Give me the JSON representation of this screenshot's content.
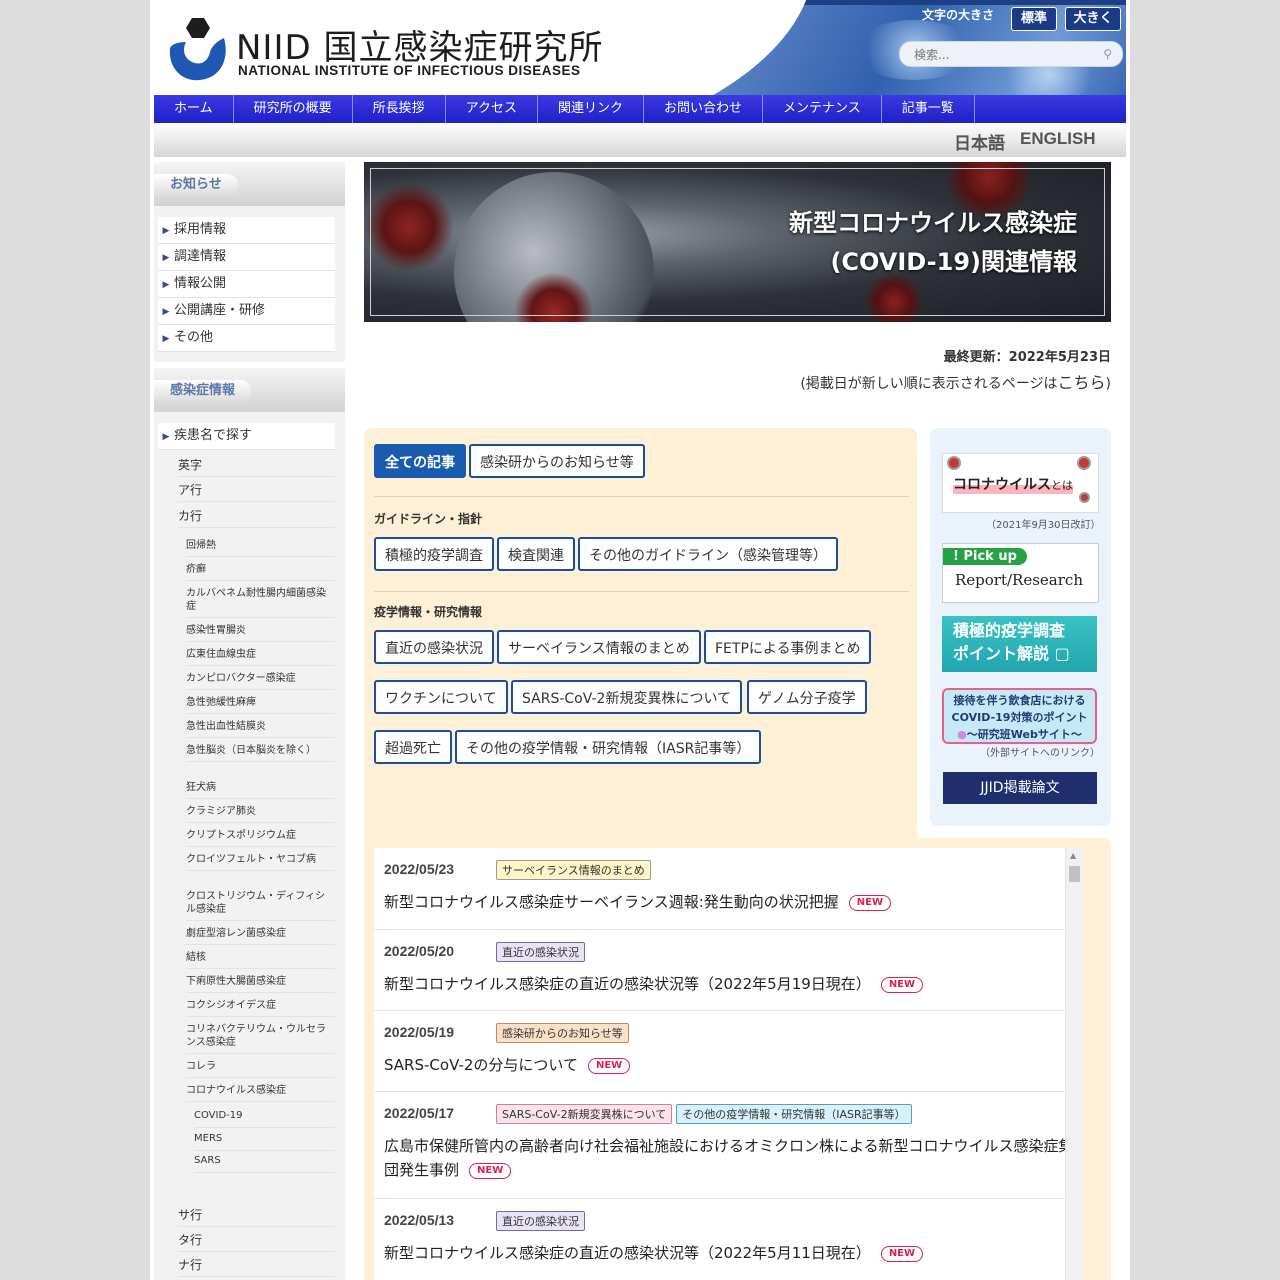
{
  "header": {
    "logo_name": "NIID 国立感染症研究所",
    "logo_en": "NATIONAL INSTITUTE OF INFECTIOUS DISEASES",
    "font_size_label": "文字の大きさ",
    "font_standard": "標準",
    "font_large": "大きく",
    "search_placeholder": "検索..."
  },
  "nav": [
    "ホーム",
    "研究所の概要",
    "所長挨拶",
    "アクセス",
    "関連リンク",
    "お問い合わせ",
    "メンテナンス",
    "記事一覧"
  ],
  "lang": {
    "ja": "日本語",
    "en": "ENGLISH"
  },
  "sidebar": {
    "notice_head": "お知らせ",
    "notice_items": [
      "採用情報",
      "調達情報",
      "情報公開",
      "公開講座・研修",
      "その他"
    ],
    "disease_head": "感染症情報",
    "search_by_name": "疾患名で探す",
    "groups": [
      "英字",
      "ア行",
      "カ行"
    ],
    "ka_items": [
      "回帰熱",
      "疥癬",
      "カルバペネム耐性腸内細菌感染症",
      "感染性胃腸炎",
      "広東住血線虫症",
      "カンピロバクター感染症",
      "急性弛緩性麻痺",
      "急性出血性結膜炎",
      "急性脳炎（日本脳炎を除く）",
      "狂犬病",
      "クラミジア肺炎",
      "クリプトスポリジウム症",
      "クロイツフェルト・ヤコブ病",
      "クロストリジウム・ディフィシル感染症",
      "劇症型溶レン菌感染症",
      "結核",
      "下痢原性大腸菌感染症",
      "コクシジオイデス症",
      "コリネバクテリウム・ウルセランス感染症",
      "コレラ",
      "コロナウイルス感染症"
    ],
    "corona_sub": [
      "COVID-19",
      "MERS",
      "SARS"
    ],
    "more_groups": [
      "サ行",
      "タ行",
      "ナ行"
    ]
  },
  "banner": {
    "line1": "新型コロナウイルス感染症",
    "line2": "(COVID-19)関連情報"
  },
  "updated": "最終更新：2022年5月23日",
  "recent_note": {
    "text": "(掲載日が新しい順に表示されるページは",
    "link": "こちら",
    "close": ")"
  },
  "filters": {
    "top": [
      "全ての記事",
      "感染研からのお知らせ等"
    ],
    "section1": "ガイドライン・指針",
    "guidelines": [
      "積極的疫学調査",
      "検査関連",
      "その他のガイドライン（感染管理等）"
    ],
    "section2": "疫学情報・研究情報",
    "epi_row1": [
      "直近の感染状況",
      "サーベイランス情報のまとめ",
      "FETPによる事例まとめ"
    ],
    "epi_row2": [
      "ワクチンについて",
      "SARS-CoV-2新規変異株について",
      "ゲノム分子疫学"
    ],
    "epi_row3": [
      "超過死亡",
      "その他の疫学情報・研究情報（IASR記事等）"
    ]
  },
  "right": {
    "corona_main": "コロナウイルス",
    "corona_small": "とは",
    "corona_date": "（2021年9月30日改訂）",
    "pickup": "! Pick up",
    "pickup_sub": "Report/Research",
    "seki_line1": "積極的疫学調査",
    "seki_line2": "ポイント解説",
    "rest_line1": "接待を伴う飲食店における",
    "rest_line2": "COVID-19対策のポイント",
    "rest_line3": "～研究班Webサイト～",
    "ext_note": "（外部サイトへのリンク）",
    "jjid": "JJID掲載論文"
  },
  "news": [
    {
      "date": "2022/05/23",
      "tags": [
        {
          "label": "サーベイランス情報のまとめ",
          "kind": "t-surv"
        }
      ],
      "title": "新型コロナウイルス感染症サーベイランス週報:発生動向の状況把握",
      "badge": "NEW"
    },
    {
      "date": "2022/05/20",
      "tags": [
        {
          "label": "直近の感染状況",
          "kind": "t-recent"
        }
      ],
      "title": "新型コロナウイルス感染症の直近の感染状況等（2022年5月19日現在）",
      "badge": "NEW"
    },
    {
      "date": "2022/05/19",
      "tags": [
        {
          "label": "感染研からのお知らせ等",
          "kind": "t-notice"
        }
      ],
      "title": "SARS-CoV-2の分与について",
      "badge": "NEW"
    },
    {
      "date": "2022/05/17",
      "tags": [
        {
          "label": "SARS-CoV-2新規変異株について",
          "kind": "t-variant"
        },
        {
          "label": "その他の疫学情報・研究情報（IASR記事等）",
          "kind": "t-other"
        }
      ],
      "title": "広島市保健所管内の高齢者向け社会福祉施設におけるオミクロン株による新型コロナウイルス感染症集団発生事例",
      "badge": "NEW"
    },
    {
      "date": "2022/05/13",
      "tags": [
        {
          "label": "直近の感染状況",
          "kind": "t-recent"
        }
      ],
      "title": "新型コロナウイルス感染症の直近の感染状況等（2022年5月11日現在）",
      "badge": "NEW"
    }
  ],
  "colors": {
    "nav": "#2a2ad8",
    "accent": "#1a5bb0",
    "panel": "#fdf0d6",
    "new_badge": "#d8234f"
  }
}
